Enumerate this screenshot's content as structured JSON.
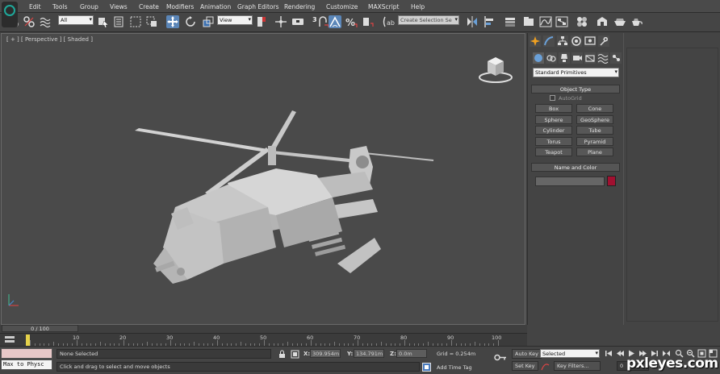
{
  "menu": [
    "Edit",
    "Tools",
    "Group",
    "Views",
    "Create",
    "Modifiers",
    "Animation",
    "Graph Editors",
    "Rendering",
    "Customize",
    "MAXScript",
    "Help"
  ],
  "toolbar": {
    "filter_select": "All",
    "refcoord_select": "View",
    "snap_text": "3",
    "selection_set_placeholder": "Create Selection Se"
  },
  "viewport": {
    "label": "[ + ] [ Perspective ] [ Shaded ]"
  },
  "panel": {
    "category": "Standard Primitives",
    "object_type_title": "Object Type",
    "autogrid": "AutoGrid",
    "autogrid_checked": false,
    "buttons": [
      "Box",
      "Cone",
      "Sphere",
      "GeoSphere",
      "Cylinder",
      "Tube",
      "Torus",
      "Pyramid",
      "Teapot",
      "Plane"
    ],
    "name_color_title": "Name and Color",
    "object_color": "#a01030"
  },
  "timeline": {
    "frame_counter": "0 / 100",
    "ticks": [
      "10",
      "20",
      "30",
      "40",
      "50",
      "60",
      "70",
      "80",
      "90",
      "100"
    ]
  },
  "status": {
    "script_line": "Max to Physc",
    "selection": "None Selected",
    "prompt": "Click and drag to select and move objects",
    "x_label": "X:",
    "x_value": "309.954m",
    "y_label": "Y:",
    "y_value": "134.791m",
    "z_label": "Z:",
    "z_value": "0.0m",
    "grid": "Grid = 0.254m",
    "add_time_tag": "Add Time Tag",
    "auto_key": "Auto Key",
    "set_key": "Set Key",
    "selected_dropdown": "Selected",
    "key_filters": "Key Filters...",
    "current_frame": "0"
  },
  "watermark": "pxleyes.com",
  "colors": {
    "accent_active": "#5b86b8",
    "time_marker": "#e6d24a",
    "viewport_bg": "#4a4a4a"
  }
}
